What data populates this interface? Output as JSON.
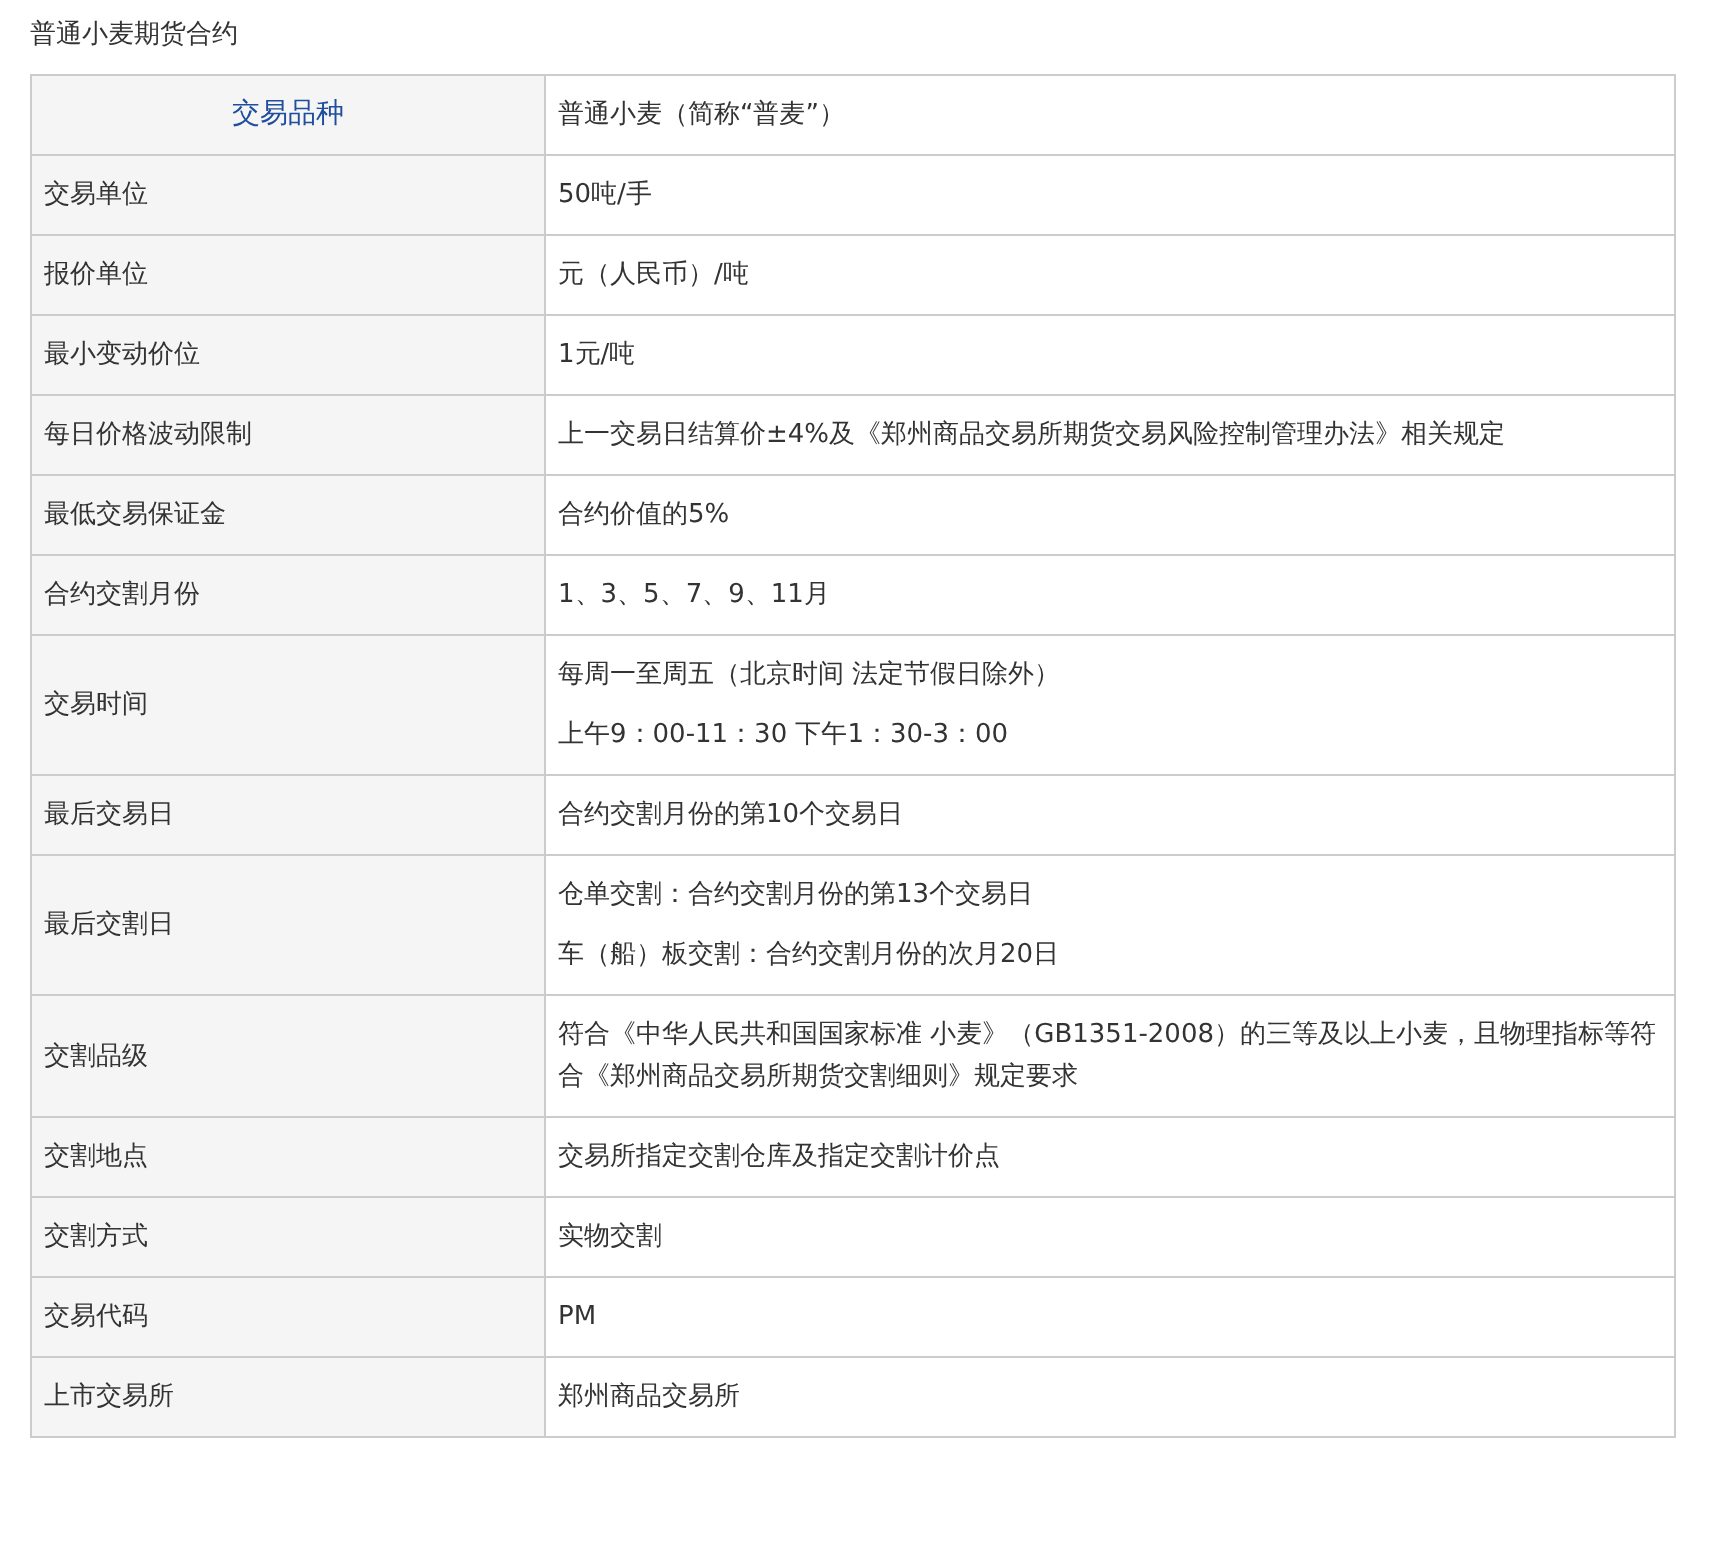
{
  "title": "普通小麦期货合约",
  "table": {
    "header": {
      "label": "交易品种",
      "value": "普通小麦（简称“普麦”）"
    },
    "rows": [
      {
        "label": "交易单位",
        "lines": [
          "50吨/手"
        ]
      },
      {
        "label": "报价单位",
        "lines": [
          "元（人民币）/吨"
        ]
      },
      {
        "label": "最小变动价位",
        "lines": [
          "1元/吨"
        ]
      },
      {
        "label": "每日价格波动限制",
        "lines": [
          "上一交易日结算价±4%及《郑州商品交易所期货交易风险控制管理办法》相关规定"
        ]
      },
      {
        "label": "最低交易保证金",
        "lines": [
          "合约价值的5%"
        ]
      },
      {
        "label": "合约交割月份",
        "lines": [
          "1、3、5、7、9、11月"
        ]
      },
      {
        "label": "交易时间",
        "lines": [
          "每周一至周五（北京时间 法定节假日除外）",
          "上午9：00-11：30 下午1：30-3：00"
        ]
      },
      {
        "label": "最后交易日",
        "lines": [
          "合约交割月份的第10个交易日"
        ]
      },
      {
        "label": "最后交割日",
        "lines": [
          "仓单交割：合约交割月份的第13个交易日",
          "车（船）板交割：合约交割月份的次月20日"
        ]
      },
      {
        "label": "交割品级",
        "lines": [
          "符合《中华人民共和国国家标准 小麦》（GB1351-2008）的三等及以上小麦，且物理指标等符合《郑州商品交易所期货交割细则》规定要求"
        ]
      },
      {
        "label": "交割地点",
        "lines": [
          "交易所指定交割仓库及指定交割计价点"
        ]
      },
      {
        "label": "交割方式",
        "lines": [
          "实物交割"
        ]
      },
      {
        "label": "交易代码",
        "lines": [
          "PM"
        ]
      },
      {
        "label": "上市交易所",
        "lines": [
          "郑州商品交易所"
        ]
      }
    ]
  }
}
